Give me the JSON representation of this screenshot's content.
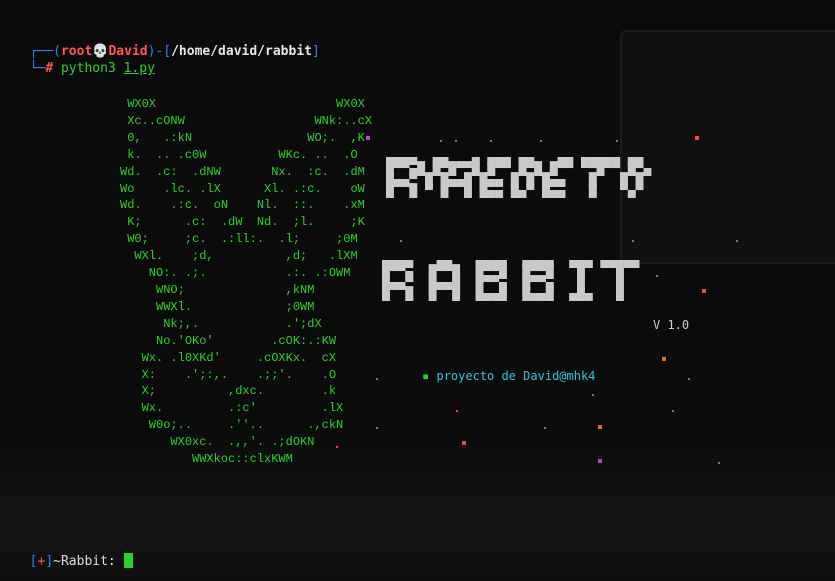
{
  "terminal": {
    "prompt_line1": {
      "corner": "┌──(",
      "user": "root",
      "skull": "💀",
      "host": "David",
      "sep": ")-[",
      "path": "/home/david/rabbit",
      "close": "]"
    },
    "prompt_line2": {
      "corner": "└─",
      "hash": "#",
      "command": "python3",
      "argument": "1.py"
    }
  },
  "ascii_art": "      WX0X                         WX0X\n      Xc..cONW                  WNk:..cX\n      0,   .:kN                WO;.  ,K\n      k.  .. .c0W          WKc. ..  .O\n     Wd.  .c:  .dNW       Nx.  :c.  .dM\n     Wo    .lc. .lX      Xl. .:c.    oW\n     Wd.    .:c.  oN    Nl.  ::.    .xM\n      K;      .c:  .dW  Nd.  ;l.     ;K\n      W0;     ;c.  .:ll:.  .l;     ;0M\n       WXl.    ;d,          ,d;   .lXM\n         NO:. .;.           .:. .:OWM\n          WNO;              ,kNM\n          WWXl.             ;0WM\n           Nk;,.            .';dX\n          No.'OKo'        .cOK:.:KW\n        Wx. .l0XKd'     .cOXKx.  cX\n        X:    .';:,.    .;;'.    .O\n        X;          ,dxc.        .k\n        Wx.         .:c'         .lX\n         W0o;..     .''..      .,ckN\n            WX0xc.  .,,'. .;dOKN\n               WWXkoc::clxKWM",
  "banner_line1": "▄▄▄▄  ▄▄   ▄ ▄▄▄ ▄▄   ▄▄ ▄▄▄▄▄ ▄▄\n█▀▀▄█ █▀█▀▀█ █▀▀ █▀█ █▀▀ ▀▀█▀▀ █▀▄\n█▄▄▀ █ █▄▄█ █▄▄ █ █ █▄▄   █   █ █\n█  █ ▀ █  █ █▄▄ █▄▀ █▄▄   █   ▀▄▀",
  "banner_line2": "▄▄▄▄   ▄▄   ▄▄▄▄  ▄▄▄▄  ▄▄▄ ▄▄▄▄▄\n█▀▀▄  █▀▀█  █▀▀█  █▀▀█   █    █\n█▄▄▀  █▄▄█  █▀▀▄  █▀▀▄   █    █\n█  █  █  █  █▄▄█  █▄▄█  ▄█▄   █",
  "version": "V 1.0",
  "credit": {
    "bullet": "▪",
    "text": "proyecto de David@mhk4"
  },
  "input_prompt": {
    "open": "[",
    "plus": "+",
    "close": "]",
    "label": "~Rabbit:"
  },
  "colors": {
    "background": "#0b0b0c",
    "ascii_green": "#2bd32b",
    "prompt_blue": "#3b7bff",
    "prompt_red": "#ff5555",
    "credit_cyan": "#29c9d9",
    "cursor_green": "#28d428"
  }
}
